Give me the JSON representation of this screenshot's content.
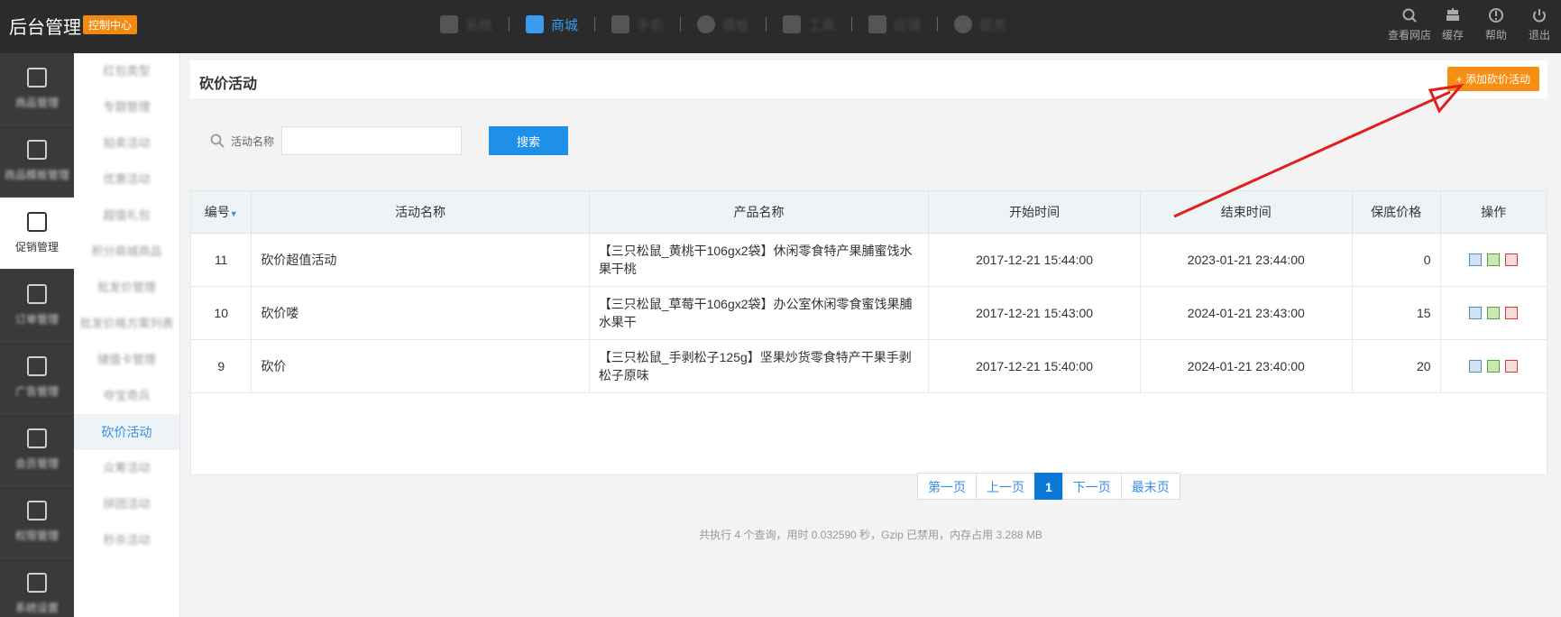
{
  "header": {
    "brand": "后台管理",
    "badge": "控制中心",
    "nav": [
      {
        "label": "系统",
        "icon": "grid-icon",
        "active": false
      },
      {
        "label": "商城",
        "icon": "image-icon",
        "active": true
      },
      {
        "label": "手机",
        "icon": "phone-icon",
        "active": false
      },
      {
        "label": "模板",
        "icon": "palette-icon",
        "active": false
      },
      {
        "label": "工具",
        "icon": "tools-icon",
        "active": false
      },
      {
        "label": "店铺",
        "icon": "store-icon",
        "active": false
      },
      {
        "label": "服务",
        "icon": "service-icon",
        "active": false
      }
    ],
    "tools": [
      {
        "label": "查看网店",
        "icon": "search-icon"
      },
      {
        "label": "缓存",
        "icon": "cache-icon"
      },
      {
        "label": "帮助",
        "icon": "help-icon"
      },
      {
        "label": "退出",
        "icon": "power-icon"
      }
    ]
  },
  "iconbar": [
    {
      "label": "商品管理",
      "active": false
    },
    {
      "label": "商品模板管理",
      "active": false
    },
    {
      "label": "促销管理",
      "active": true
    },
    {
      "label": "订单管理",
      "active": false
    },
    {
      "label": "广告管理",
      "active": false
    },
    {
      "label": "会员管理",
      "active": false
    },
    {
      "label": "权限管理",
      "active": false
    },
    {
      "label": "系统设置",
      "active": false
    }
  ],
  "subnav": [
    {
      "label": "红包类型",
      "active": false
    },
    {
      "label": "专题管理",
      "active": false
    },
    {
      "label": "拍卖活动",
      "active": false
    },
    {
      "label": "优惠活动",
      "active": false
    },
    {
      "label": "超值礼包",
      "active": false
    },
    {
      "label": "积分商城商品",
      "active": false
    },
    {
      "label": "批发价管理",
      "active": false
    },
    {
      "label": "批发价格方案列表",
      "active": false
    },
    {
      "label": "储值卡管理",
      "active": false
    },
    {
      "label": "夺宝奇兵",
      "active": false
    },
    {
      "label": "砍价活动",
      "active": true
    },
    {
      "label": "众筹活动",
      "active": false
    },
    {
      "label": "拼团活动",
      "active": false
    },
    {
      "label": "秒杀活动",
      "active": false
    }
  ],
  "page": {
    "title": "砍价活动",
    "add_button": "+ 添加砍价活动"
  },
  "search": {
    "label": "活动名称",
    "value": "",
    "placeholder": "",
    "button": "搜索"
  },
  "table": {
    "columns": [
      "编号",
      "活动名称",
      "产品名称",
      "开始时间",
      "结束时间",
      "保底价格",
      "操作"
    ],
    "sort_indicator": "▼",
    "rows": [
      {
        "id": "11",
        "name": "砍价超值活动",
        "product": "【三只松鼠_黄桃干106gx2袋】休闲零食特产果脯蜜饯水果干桃",
        "start": "2017-12-21 15:44:00",
        "end": "2023-01-21 23:44:00",
        "price": "0"
      },
      {
        "id": "10",
        "name": "砍价喽",
        "product": "【三只松鼠_草莓干106gx2袋】办公室休闲零食蜜饯果脯水果干",
        "start": "2017-12-21 15:43:00",
        "end": "2024-01-21 23:43:00",
        "price": "15"
      },
      {
        "id": "9",
        "name": "砍价",
        "product": "【三只松鼠_手剥松子125g】坚果炒货零食特产干果手剥松子原味",
        "start": "2017-12-21 15:40:00",
        "end": "2024-01-21 23:40:00",
        "price": "20"
      }
    ]
  },
  "pager": {
    "first": "第一页",
    "prev": "上一页",
    "current": "1",
    "next": "下一页",
    "last": "最末页"
  },
  "footer": {
    "text": "共执行 4 个查询，用时 0.032590 秒，Gzip 已禁用，内存占用 3.288 MB"
  },
  "colors": {
    "accent": "#1e90e8",
    "orange": "#f88f14",
    "arrow": "#e02020"
  }
}
